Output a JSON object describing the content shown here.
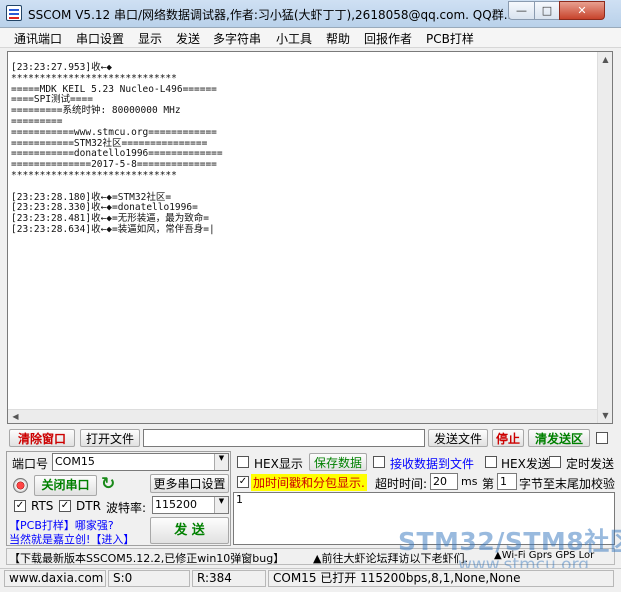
{
  "window": {
    "title": "SSCOM V5.12 串口/网络数据调试器,作者:习小猛(大虾丁丁),2618058@qq.com. QQ群...",
    "min": "—",
    "max": "□",
    "close": "✕"
  },
  "menu": [
    "通讯端口",
    "串口设置",
    "显示",
    "发送",
    "多字符串",
    "小工具",
    "帮助",
    "回报作者",
    "PCB打样"
  ],
  "receive_lines": [
    "[23:23:27.953]收←◆",
    "*****************************",
    "=====MDK KEIL 5.23 Nucleo-L496======",
    "====SPI测试====",
    "=========系统时钟: 80000000 MHz",
    "=========",
    "===========www.stmcu.org============",
    "===========STM32社区===============",
    "===========donatello1996=============",
    "==============2017-5-8==============",
    "*****************************",
    "",
    "[23:23:28.180]收←◆=STM32社区=",
    "[23:23:28.330]收←◆=donatello1996=",
    "[23:23:28.481]收←◆=无形装逼，最为致命=",
    "[23:23:28.634]收←◆=装逼如风，常伴吾身=|"
  ],
  "toolbar": {
    "clear": "清除窗口",
    "open_file": "打开文件",
    "send_file": "发送文件",
    "stop": "停止",
    "clear_send": "清发送区"
  },
  "port": {
    "label": "端口号",
    "value": "COM15",
    "close_btn": "关闭串口",
    "more": "更多串口设置",
    "rts": "RTS",
    "dtr": "DTR",
    "baud_label": "波特率:",
    "baud": "115200"
  },
  "opts": {
    "hex_show": "HEX显示",
    "save": "保存数据",
    "recv_file": "接收数据到文件",
    "hex_send": "HEX发送",
    "timed": "定时发送",
    "timestamp": "加时间戳和分包显示.",
    "timeout_label": "超时时间:",
    "timeout": "20",
    "ms": "ms",
    "nth": "第",
    "nth_val": "1",
    "byte_to_end": "字节至末尾加校验"
  },
  "send_text": "1",
  "send_btn": "发 送",
  "promo": {
    "pcb": "【PCB打样】哪家强?",
    "ad": "当然就是嘉立创!【进入】"
  },
  "ticker": {
    "left": "【下载最新版本SSCOM5.12.2,已修正win10弹窗bug】",
    "mid": "▲前往大虾论坛拜访以下老虾们.",
    "right": "▲Wi-Fi Gprs GPS Lor"
  },
  "status": {
    "site": "www.daxia.com",
    "s": "S:0",
    "r": "R:384",
    "port_status": "COM15 已打开  115200bps,8,1,None,None"
  },
  "watermark": {
    "main": "STM32/STM8社区",
    "sub": "www.stmcu.org"
  },
  "colors": {
    "accent": "#c00000",
    "green": "#008000",
    "blue": "#0000ff",
    "timestamp_bg": "#ffff00"
  }
}
